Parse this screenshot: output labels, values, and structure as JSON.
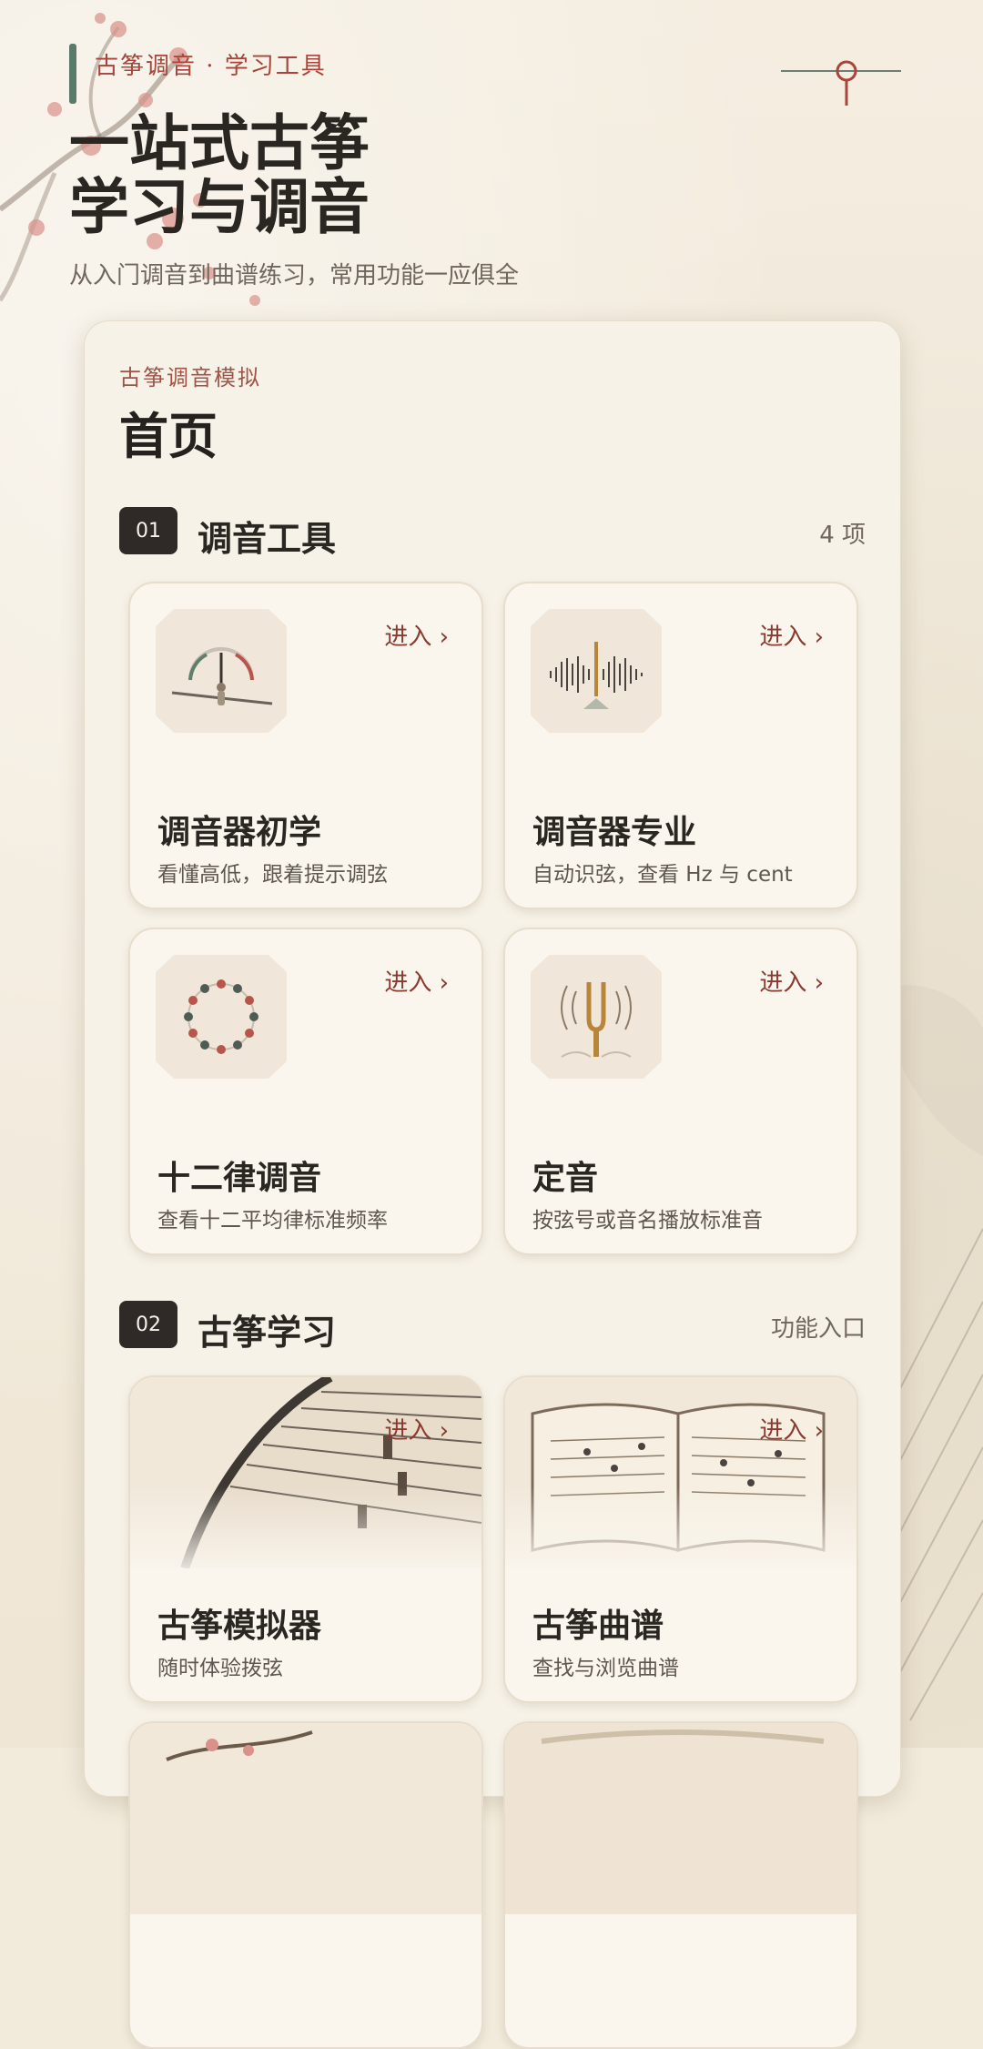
{
  "header": {
    "tag": "古筝调音 · 学习工具",
    "title_line1": "一站式古筝",
    "title_line2": "学习与调音",
    "subtitle": "从入门调音到曲谱练习，常用功能一应俱全"
  },
  "panel": {
    "caption": "古筝调音模拟",
    "title": "首页"
  },
  "sections": [
    {
      "badge": "01",
      "title": "调音工具",
      "meta": "4 项",
      "cards": [
        {
          "title": "调音器初学",
          "desc": "看懂高低，跟着提示调弦",
          "enter": "进入 ›",
          "icon": "gauge-icon"
        },
        {
          "title": "调音器专业",
          "desc": "自动识弦，查看 Hz 与 cent",
          "enter": "进入 ›",
          "icon": "waveform-icon"
        },
        {
          "title": "十二律调音",
          "desc": "查看十二平均律标准频率",
          "enter": "进入 ›",
          "icon": "circle-of-notes-icon"
        },
        {
          "title": "定音",
          "desc": "按弦号或音名播放标准音",
          "enter": "进入 ›",
          "icon": "tuning-fork-icon"
        }
      ]
    },
    {
      "badge": "02",
      "title": "古筝学习",
      "meta": "功能入口",
      "cards": [
        {
          "title": "古筝模拟器",
          "desc": "随时体验拨弦",
          "enter": "进入 ›",
          "icon": "guzheng-illustration"
        },
        {
          "title": "古筝曲谱",
          "desc": "查找与浏览曲谱",
          "enter": "进入 ›",
          "icon": "sheet-music-book-illustration"
        }
      ]
    }
  ],
  "colors": {
    "accent_red": "#a8443a",
    "accent_green": "#5a7a6a",
    "badge_dark": "#2f2a27",
    "paper": "#f7f2e8"
  }
}
